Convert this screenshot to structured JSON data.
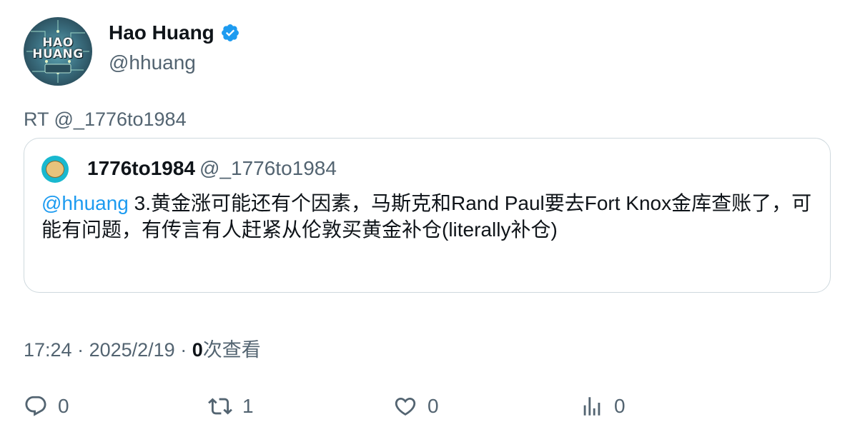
{
  "author": {
    "display_name": "Hao Huang",
    "handle": "@hhuang",
    "verified": true,
    "avatar_logo_text": "HAO HUANG",
    "verified_color": "#1d9bf0"
  },
  "retweet_label": "RT @_1776to1984",
  "quoted_tweet": {
    "display_name": "1776to1984",
    "handle": "@_1776to1984",
    "mention": "@hhuang",
    "text": " 3.黄金涨可能还有个因素，马斯克和Rand Paul要去Fort Knox金库查账了，可能有问题，有传言有人赶紧从伦敦买黄金补仓(literally补仓)"
  },
  "meta": {
    "time": "17:24",
    "separator": " · ",
    "date": "2025/2/19",
    "views_count": "0",
    "views_label": "次查看"
  },
  "actions": {
    "reply_count": "0",
    "retweet_count": "1",
    "like_count": "0",
    "views_count": "0"
  },
  "colors": {
    "accent": "#1d9bf0",
    "secondary_text": "#536471",
    "border": "#cfd9de"
  }
}
